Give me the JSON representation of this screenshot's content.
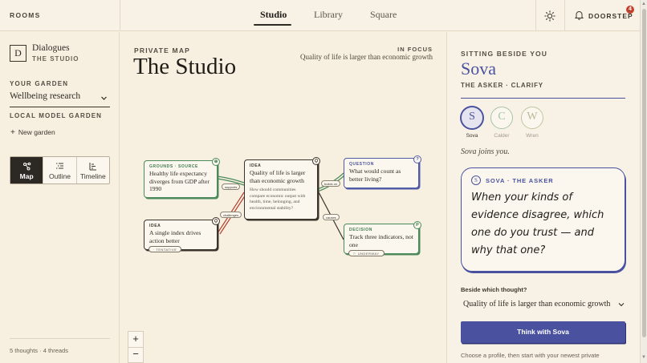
{
  "topbar": {
    "rooms_label": "ROOMS",
    "tabs": [
      {
        "label": "Studio"
      },
      {
        "label": "Library"
      },
      {
        "label": "Square"
      }
    ],
    "doorstep_label": "DOORSTEP",
    "notification_count": "4"
  },
  "sidebar": {
    "logo_letter": "D",
    "title": "Dialogues",
    "subtitle": "THE STUDIO",
    "garden_heading": "YOUR GARDEN",
    "garden_selected": "Wellbeing research",
    "local_heading": "LOCAL MODEL GARDEN",
    "new_garden_label": "New garden",
    "views": [
      {
        "label": "Map",
        "icon": "map-icon",
        "active": true
      },
      {
        "label": "Outline",
        "icon": "outline-icon"
      },
      {
        "label": "Timeline",
        "icon": "timeline-icon"
      }
    ],
    "thread_count": "5 thoughts · 4 threads"
  },
  "main": {
    "map_label": "PRIVATE MAP",
    "title": "The Studio",
    "focus_label": "IN FOCUS",
    "focus_text": "Quality of life is larger than economic growth",
    "cards": {
      "grounds": {
        "kind": "GROUNDS · SOURCE",
        "text": "Healthy life expectancy diverges from GDP after 1990",
        "badge": "⊕"
      },
      "idea_main": {
        "kind": "IDEA",
        "text": "Quality of life is larger than economic growth",
        "note": "How should communities compare economic output with health, time, belonging, and environmental stability?"
      },
      "idea_small": {
        "kind": "IDEA",
        "text": "A single index drives action better",
        "pill": "· TENTATIVE"
      },
      "question": {
        "kind": "QUESTION",
        "text": "What would count as better living?",
        "badge": "?"
      },
      "decision": {
        "kind": "DECISION",
        "text": "Track three indicators, not one",
        "pill": "⚐ UNDERWAY",
        "badge": "P"
      }
    },
    "edges": {
      "supports": "supports",
      "challenges": "challenges",
      "builds_on": "builds on",
      "causes": "causes"
    },
    "zoom_in": "+",
    "zoom_out": "−"
  },
  "panel": {
    "beside_label": "SITTING BESIDE YOU",
    "partner_name": "Sova",
    "partner_role": "THE ASKER · CLARIFY",
    "avatars": [
      {
        "letter": "S",
        "name": "Sova",
        "color": "#4a52a0"
      },
      {
        "letter": "C",
        "name": "Calder",
        "color": "#a7c4a4"
      },
      {
        "letter": "W",
        "name": "Wren",
        "color": "#c0c6a1"
      }
    ],
    "joins_text": "Sova joins you.",
    "bubble_badge": "S",
    "bubble_label": "SOVA · THE ASKER",
    "bubble_text": "When your kinds of evidence disagree, which one do you trust — and why that one?",
    "thought_label": "Beside which thought?",
    "thought_selected": "Quality of life is larger than economic growth",
    "think_button": "Think with Sova",
    "hint": "Choose a profile, then start with your newest private"
  },
  "colors": {
    "accent": "#4a52a0",
    "green": "#4c8a5c",
    "red": "#b5402f",
    "background": "#f7f0e1"
  }
}
